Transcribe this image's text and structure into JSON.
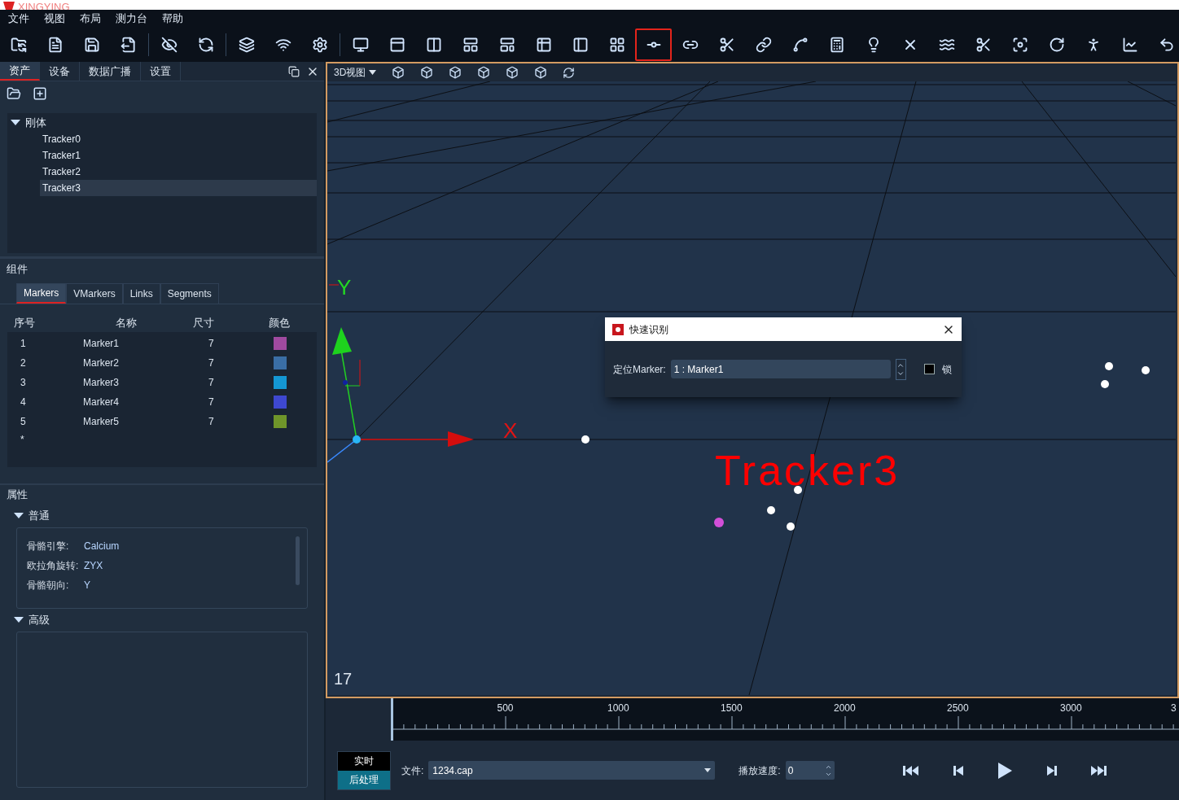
{
  "app_title": "XINGYING",
  "menu": [
    "文件",
    "视图",
    "布局",
    "测力台",
    "帮助"
  ],
  "toolbar": [
    {
      "selected": false
    },
    {
      "selected": false
    },
    {
      "selected": false
    },
    {
      "selected": false
    },
    {
      "selected": false
    },
    {
      "selected": false
    },
    {
      "selected": false
    },
    {
      "selected": false
    },
    {
      "selected": false
    },
    {
      "selected": false
    },
    {
      "selected": false
    },
    {
      "selected": false
    },
    {
      "selected": false
    },
    {
      "selected": false
    },
    {
      "selected": false
    },
    {
      "selected": false
    },
    {
      "selected": false
    },
    {
      "selected": true
    },
    {
      "selected": false
    },
    {
      "selected": false
    },
    {
      "selected": false
    },
    {
      "selected": false
    },
    {
      "selected": false
    },
    {
      "selected": false
    },
    {
      "selected": false
    },
    {
      "selected": false
    },
    {
      "selected": false
    },
    {
      "selected": false
    },
    {
      "selected": false
    },
    {
      "selected": false
    },
    {
      "selected": false
    },
    {
      "selected": false
    }
  ],
  "left_tabs": [
    {
      "label": "资产",
      "selected": true
    },
    {
      "label": "设备",
      "selected": false
    },
    {
      "label": "数据广播",
      "selected": false
    },
    {
      "label": "设置",
      "selected": false
    }
  ],
  "tree": {
    "label": "刚体",
    "expanded": true,
    "children": [
      {
        "label": "Tracker0",
        "selected": false
      },
      {
        "label": "Tracker1",
        "selected": false
      },
      {
        "label": "Tracker2",
        "selected": false
      },
      {
        "label": "Tracker3",
        "selected": true
      }
    ]
  },
  "components": {
    "title": "组件",
    "tabs": [
      {
        "label": "Markers",
        "selected": true
      },
      {
        "label": "VMarkers",
        "selected": false
      },
      {
        "label": "Links",
        "selected": false
      },
      {
        "label": "Segments",
        "selected": false
      }
    ],
    "columns": [
      "序号",
      "名称",
      "尺寸",
      "颜色"
    ],
    "rows": [
      {
        "index": "1",
        "name": "Marker1",
        "size": "7",
        "color": "#a04aa0"
      },
      {
        "index": "2",
        "name": "Marker2",
        "size": "7",
        "color": "#3a6ea5"
      },
      {
        "index": "3",
        "name": "Marker3",
        "size": "7",
        "color": "#1497d4"
      },
      {
        "index": "4",
        "name": "Marker4",
        "size": "7",
        "color": "#3e48d0"
      },
      {
        "index": "5",
        "name": "Marker5",
        "size": "7",
        "color": "#6f952a"
      }
    ],
    "new_row": "*"
  },
  "properties": {
    "title": "属性",
    "sections": [
      {
        "title": "普通",
        "expanded": true,
        "fields": [
          {
            "label": "骨骼引擎:",
            "value": "Calcium"
          },
          {
            "label": "欧拉角旋转:",
            "value": "ZYX"
          },
          {
            "label": "骨骼朝向:",
            "value": "Y"
          }
        ]
      },
      {
        "title": "高级",
        "expanded": true
      }
    ]
  },
  "viewport": {
    "view_menu": "3D视图",
    "axis_y": "Y",
    "axis_x": "X",
    "tracker_label": "Tracker3",
    "frame": "17"
  },
  "dialog": {
    "title": "快速识别",
    "field_label": "定位Marker:",
    "field_value": "1 : Marker1",
    "lock": {
      "label": "锁",
      "checked": false
    }
  },
  "timeline": {
    "ticks": [
      "500",
      "1000",
      "1500",
      "2000",
      "2500",
      "3000",
      "3"
    ]
  },
  "playback": {
    "modes": [
      {
        "label": "实时",
        "selected": false
      },
      {
        "label": "后处理",
        "selected": true
      }
    ],
    "file_label": "文件:",
    "file_value": "1234.cap",
    "speed_label": "播放速度:",
    "speed_value": "0"
  }
}
